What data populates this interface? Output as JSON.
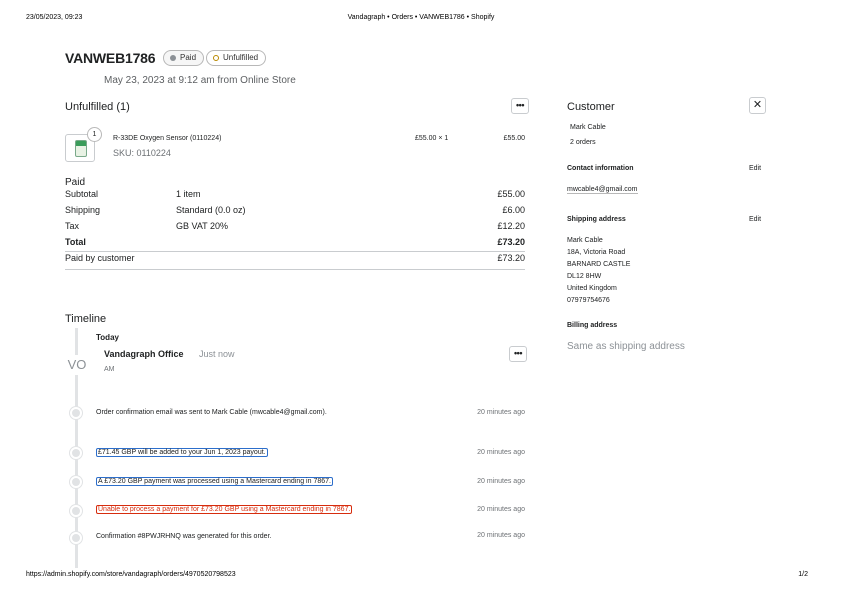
{
  "print": {
    "datetime": "23/05/2023, 09:23",
    "page_title": "Vandagraph • Orders • VANWEB1786 • Shopify",
    "url": "https://admin.shopify.com/store/vandagraph/orders/4970520798523",
    "page_number": "1/2"
  },
  "order": {
    "title": "VANWEB1786",
    "badges": {
      "paid": "Paid",
      "unfulfilled": "Unfulfilled"
    },
    "subtitle": "May 23, 2023 at 9:12 am from Online Store"
  },
  "fulfillment": {
    "title": "Unfulfilled (1)",
    "more_label": "•••",
    "item": {
      "quantity": "1",
      "name": "R-33DE Oxygen Sensor (0110224)",
      "sku": "SKU: 0110224",
      "price_qty": "£55.00 × 1",
      "total": "£55.00"
    }
  },
  "payment": {
    "title": "Paid",
    "rows": [
      {
        "label": "Subtotal",
        "desc": "1 item",
        "amount": "£55.00"
      },
      {
        "label": "Shipping",
        "desc": "Standard (0.0 oz)",
        "amount": "£6.00"
      },
      {
        "label": "Tax",
        "desc": "GB VAT 20%",
        "amount": "£12.20"
      },
      {
        "label": "Total",
        "desc": "",
        "amount": "£73.20"
      },
      {
        "label": "Paid by customer",
        "desc": "",
        "amount": "£73.20"
      }
    ]
  },
  "timeline": {
    "title": "Timeline",
    "today_label": "Today",
    "comment": {
      "avatar": "VO",
      "author": "Vandagraph Office",
      "time": "Just now",
      "ampm": "AM",
      "more_label": "•••"
    },
    "events": [
      {
        "text": "Order confirmation email was sent to Mark Cable (mwcable4@gmail.com).",
        "time": "20 minutes ago"
      },
      {
        "text": "£71.45 GBP will be added to your Jun 1, 2023 payout.",
        "time": "20 minutes ago"
      },
      {
        "text": "A £73.20 GBP payment was processed using a Mastercard ending in 7867.",
        "time": "20 minutes ago"
      },
      {
        "text": "Unable to process a payment for £73.20 GBP using a Mastercard ending in 7867.",
        "time": "20 minutes ago"
      },
      {
        "text": "Confirmation #8PWJRHNQ was generated for this order.",
        "time": "20 minutes ago"
      }
    ]
  },
  "customer": {
    "title": "Customer",
    "close_label": "✕",
    "name": "Mark Cable",
    "orders": "2 orders",
    "contact_label": "Contact information",
    "edit_label": "Edit",
    "email": "mwcable4@gmail.com",
    "shipping_label": "Shipping address",
    "address": [
      "Mark Cable",
      "18A, Victoria Road",
      "BARNARD CASTLE",
      "DL12 8HW",
      "United Kingdom",
      "07979754676"
    ],
    "billing_label": "Billing address",
    "billing_value": "Same as shipping address"
  }
}
